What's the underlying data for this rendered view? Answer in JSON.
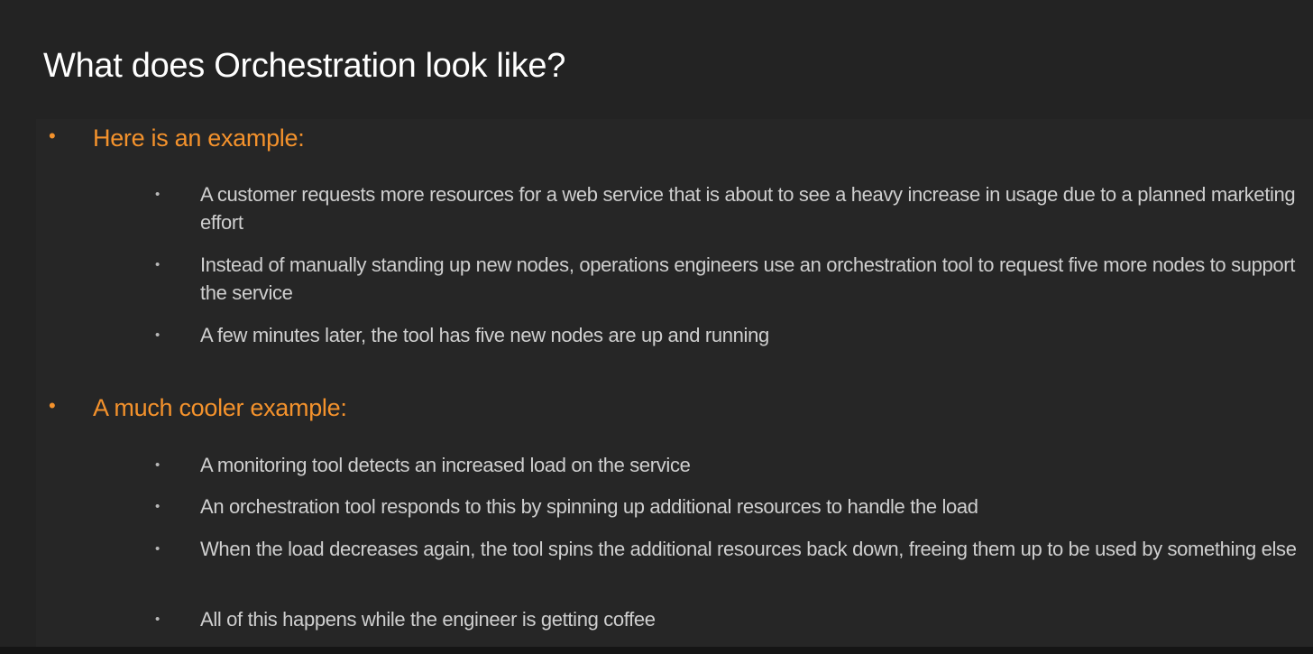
{
  "slide": {
    "title": "What does Orchestration look like?",
    "sections": [
      {
        "bullet": "•",
        "label": "Here is an example:",
        "items": [
          {
            "bullet": "•",
            "text": "A customer requests more resources for a web service that is about to see a heavy increase in usage due to a planned marketing effort"
          },
          {
            "bullet": "•",
            "text": "Instead of manually standing up new nodes, operations engineers use an orchestration tool to request five more nodes to support the service"
          },
          {
            "bullet": "•",
            "text": "A few minutes later, the tool has five new nodes are up and running"
          }
        ]
      },
      {
        "bullet": "•",
        "label": "A much cooler example:",
        "items": [
          {
            "bullet": "•",
            "text": "A monitoring tool detects an increased load on the service"
          },
          {
            "bullet": "•",
            "text": "An orchestration tool responds to this by spinning up additional resources to handle the load"
          },
          {
            "bullet": "•",
            "text": "When the load decreases again, the tool spins the additional resources back down, freeing them up to be used by something else"
          },
          {
            "bullet": "•",
            "text": "All of this happens while the engineer is getting coffee"
          }
        ]
      }
    ]
  },
  "colors": {
    "background": "#232323",
    "title": "#ffffff",
    "accent": "#f4922c",
    "body_text": "#cfcfcf"
  }
}
